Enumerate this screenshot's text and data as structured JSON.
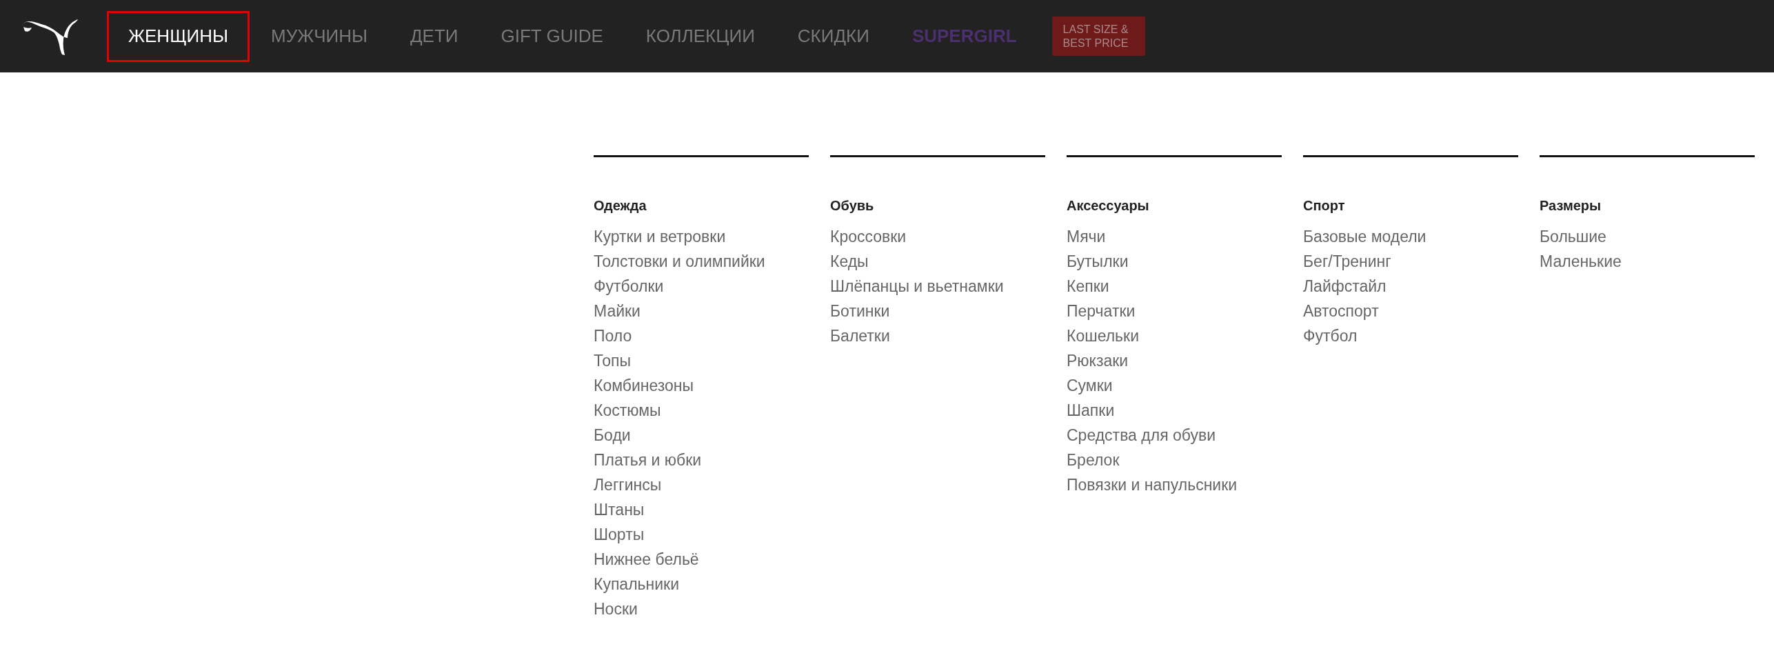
{
  "nav": [
    {
      "kind": "link",
      "label": "ЖЕНЩИНЫ",
      "selected": true
    },
    {
      "kind": "link",
      "label": "МУЖЧИНЫ",
      "selected": false
    },
    {
      "kind": "link",
      "label": "ДЕТИ",
      "selected": false
    },
    {
      "kind": "link",
      "label": "GIFT GUIDE",
      "selected": false
    },
    {
      "kind": "link",
      "label": "КОЛЛЕКЦИИ",
      "selected": false
    },
    {
      "kind": "link",
      "label": "СКИДКИ",
      "selected": false
    },
    {
      "kind": "featured",
      "label": "SUPERGIRL",
      "selected": false
    },
    {
      "kind": "badge",
      "label": "LAST SIZE & BEST PRICE"
    }
  ],
  "menu_columns": [
    {
      "heading": "Одежда",
      "items": [
        "Куртки и ветровки",
        "Толстовки и олимпийки",
        "Футболки",
        "Майки",
        "Поло",
        "Топы",
        "Комбинезоны",
        "Костюмы",
        "Боди",
        "Платья и юбки",
        "Леггинсы",
        "Штаны",
        "Шорты",
        "Нижнее бельё",
        "Купальники",
        "Носки"
      ]
    },
    {
      "heading": "Обувь",
      "items": [
        "Кроссовки",
        "Кеды",
        "Шлёпанцы и вьетнамки",
        "Ботинки",
        "Балетки"
      ]
    },
    {
      "heading": "Аксессуары",
      "items": [
        "Мячи",
        "Бутылки",
        "Кепки",
        "Перчатки",
        "Кошельки",
        "Рюкзаки",
        "Сумки",
        "Шапки",
        "Средства для обуви",
        "Брелок",
        "Повязки и напульсники"
      ]
    },
    {
      "heading": "Спорт",
      "items": [
        "Базовые модели",
        "Бег/Тренинг",
        "Лайфстайл",
        "Автоспорт",
        "Футбол"
      ]
    },
    {
      "heading": "Размеры",
      "items": [
        "Большие",
        "Маленькие"
      ]
    }
  ]
}
